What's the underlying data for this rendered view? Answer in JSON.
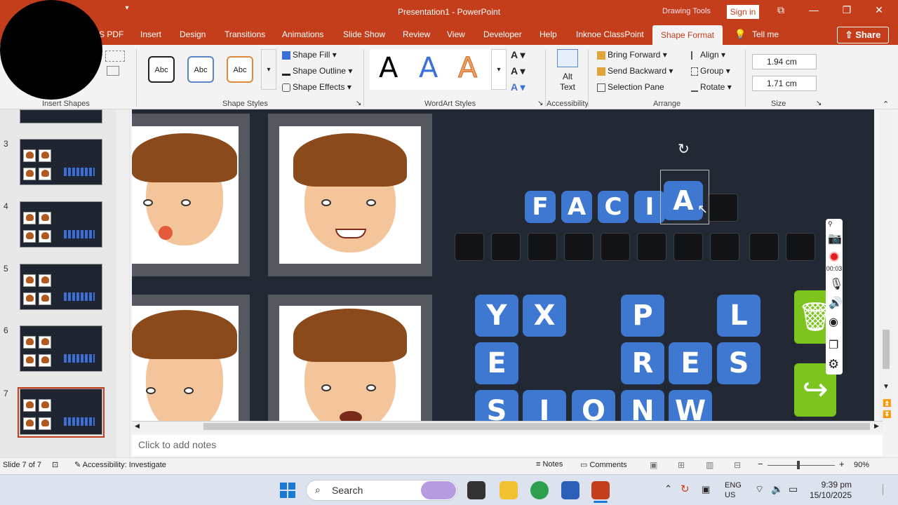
{
  "titlebar": {
    "title": "Presentation1  -  PowerPoint",
    "drawing_tools": "Drawing Tools",
    "sign_in": "Sign in"
  },
  "tabs": {
    "pdf": "S PDF",
    "insert": "Insert",
    "design": "Design",
    "transitions": "Transitions",
    "animations": "Animations",
    "slide_show": "Slide Show",
    "review": "Review",
    "view": "View",
    "developer": "Developer",
    "help": "Help",
    "inknoe": "Inknoe ClassPoint",
    "shape_format": "Shape Format",
    "tell_me": "Tell me",
    "share": "Share"
  },
  "ribbon": {
    "insert_shapes": "Insert Shapes",
    "shape_styles": "Shape Styles",
    "style_samples": [
      "Abc",
      "Abc",
      "Abc"
    ],
    "shape_fill": "Shape Fill",
    "shape_outline": "Shape Outline",
    "shape_effects": "Shape Effects",
    "wordart_styles": "WordArt Styles",
    "wordart_letters": [
      "A",
      "A",
      "A"
    ],
    "alt_text": "Alt Text",
    "alt_text_line1": "Alt",
    "alt_text_line2": "Text",
    "accessibility": "Accessibility",
    "bring_forward": "Bring Forward",
    "send_backward": "Send Backward",
    "selection_pane": "Selection Pane",
    "align": "Align",
    "group": "Group",
    "rotate": "Rotate",
    "arrange": "Arrange",
    "height": "1.94 cm",
    "width": "1.71 cm",
    "size": "Size"
  },
  "thumbnails": {
    "numbers": [
      "3",
      "4",
      "5",
      "6",
      "7"
    ],
    "selected": "7"
  },
  "slide": {
    "answer_tiles": [
      "F",
      "A",
      "C",
      "I",
      "A"
    ],
    "tiles_row1": [
      "Y",
      "X",
      "P",
      "L"
    ],
    "tiles_row2": [
      "E",
      "R",
      "E",
      "S"
    ],
    "tiles_row3": [
      "S",
      "I",
      "O",
      "N",
      "W"
    ],
    "record_time": "00:03"
  },
  "notes_placeholder": "Click to add notes",
  "status": {
    "slide": "Slide 7 of 7",
    "accessibility": "Accessibility: Investigate",
    "notes": "Notes",
    "comments": "Comments",
    "zoom": "90%"
  },
  "taskbar": {
    "search": "Search",
    "lang1": "ENG",
    "lang2": "US",
    "time": "9:39 pm",
    "date": "15/10/2025"
  },
  "colors": {
    "accent": "#c43e1c",
    "tile_blue": "#3f78d1",
    "slide_bg": "#222834",
    "green": "#7dc41e"
  }
}
